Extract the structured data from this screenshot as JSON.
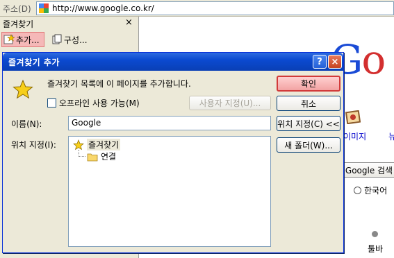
{
  "address_bar": {
    "label": "주소(D)",
    "url": "http://www.google.co.kr/"
  },
  "favorites_pane": {
    "title": "즐겨찾기",
    "close_glyph": "×",
    "add_label": "추가...",
    "organize_label": "구성..."
  },
  "web_page": {
    "logo_text": "Go",
    "images_label": "이미지",
    "news_label_partial": "뉴",
    "search_button": "Google 검색",
    "korean_radio": "한국어",
    "toolbar_label": "툴바"
  },
  "dialog": {
    "title": "즐겨찾기 추가",
    "help_glyph": "?",
    "close_glyph": "×",
    "description": "즐겨찾기 목록에 이 페이지를 추가합니다.",
    "offline_checkbox": "오프라인 사용 가능(M)",
    "offline_checked": false,
    "customize_button": "사용자 지정(U)...",
    "name_label": "이름(N):",
    "name_value": "Google",
    "location_label": "위치 지정(I):",
    "ok_button": "확인",
    "cancel_button": "취소",
    "create_in_button": "위치 지정(C) <<",
    "new_folder_button": "새 폴더(W)...",
    "tree": {
      "root": "즐겨찾기",
      "children": [
        "연결"
      ]
    }
  },
  "colors": {
    "titlebar": "#0b4ad0",
    "default_button": "#f2a3a3",
    "dialog_bg": "#ece9d8"
  }
}
